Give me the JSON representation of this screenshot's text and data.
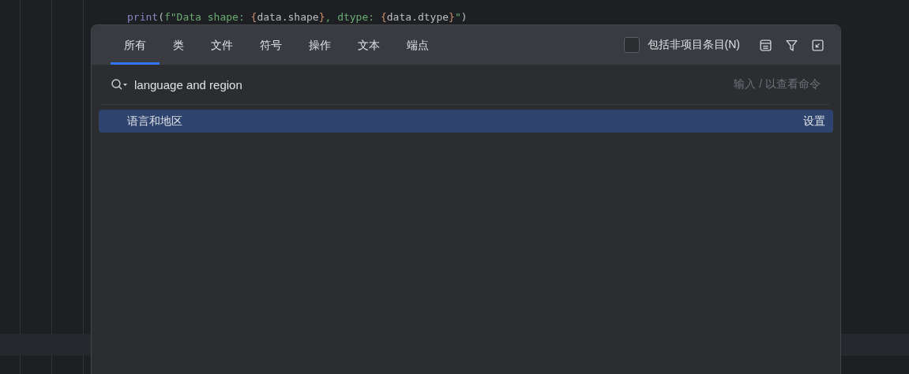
{
  "editor": {
    "code_lines": [
      {
        "segments": [
          {
            "text": "print",
            "kind": "builtin"
          },
          {
            "text": "(",
            "kind": "plain"
          },
          {
            "text": "f\"Data shape: ",
            "kind": "string"
          },
          {
            "text": "{",
            "kind": "brace"
          },
          {
            "text": "data.shape",
            "kind": "plain"
          },
          {
            "text": "}",
            "kind": "brace"
          },
          {
            "text": ", dtype: ",
            "kind": "string"
          },
          {
            "text": "{",
            "kind": "brace"
          },
          {
            "text": "data.dtype",
            "kind": "plain"
          },
          {
            "text": "}",
            "kind": "brace"
          },
          {
            "text": "\"",
            "kind": "string"
          },
          {
            "text": ")",
            "kind": "plain"
          }
        ]
      }
    ]
  },
  "popup": {
    "tabs": [
      {
        "label": "所有",
        "selected": true
      },
      {
        "label": "类",
        "selected": false
      },
      {
        "label": "文件",
        "selected": false
      },
      {
        "label": "符号",
        "selected": false
      },
      {
        "label": "操作",
        "selected": false
      },
      {
        "label": "文本",
        "selected": false
      },
      {
        "label": "端点",
        "selected": false
      }
    ],
    "include_non_project": {
      "label": "包括非项目条目(N)",
      "checked": false
    },
    "search": {
      "value": "language and region",
      "hint": "输入 / 以查看命令"
    },
    "results": [
      {
        "label": "语言和地区",
        "category": "设置",
        "selected": true
      }
    ]
  }
}
